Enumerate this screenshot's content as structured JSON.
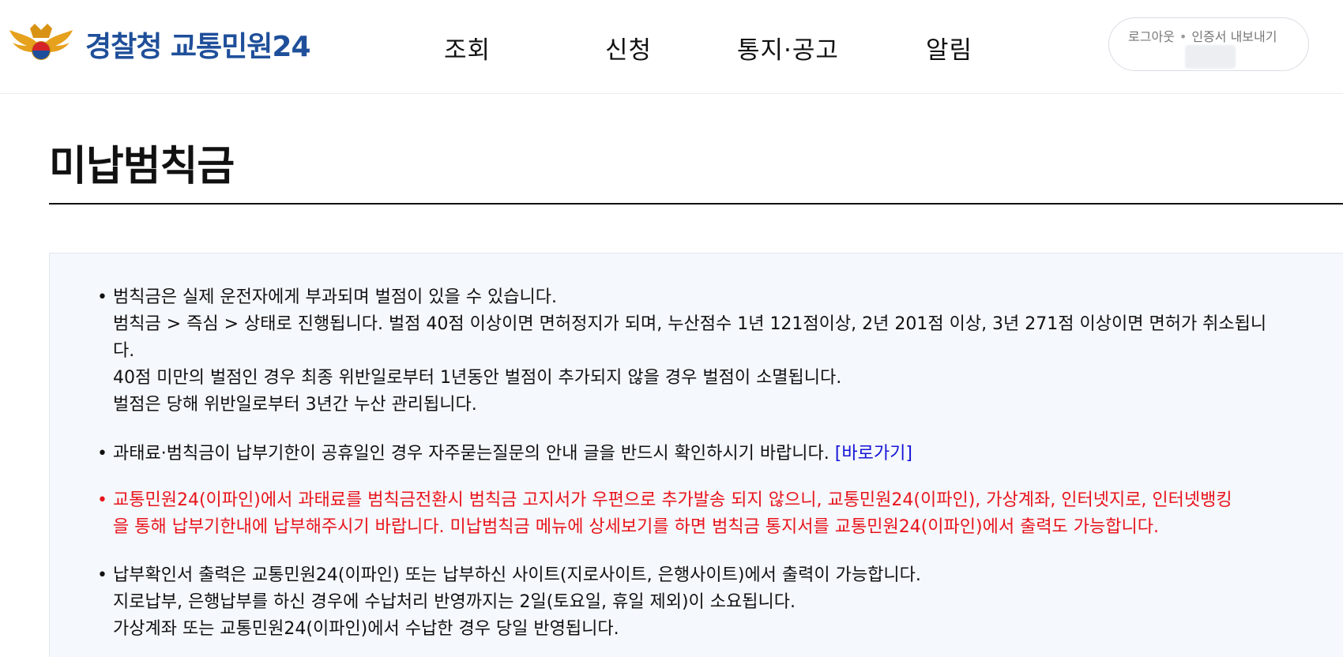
{
  "header": {
    "logo_brand": "경찰청",
    "logo_service": "교통민원24",
    "nav": [
      "조회",
      "신청",
      "통지·공고",
      "알림"
    ],
    "user_links": {
      "logout": "로그아웃",
      "export_cert": "인증서 내보내기"
    }
  },
  "page": {
    "title": "미납범칙금"
  },
  "notes": [
    {
      "bullet": "•",
      "lines": [
        "범칙금은 실제 운전자에게 부과되며 벌점이 있을 수 있습니다.",
        "범칙금 > 즉심 > 상태로 진행됩니다. 벌점 40점 이상이면 면허정지가 되며, 누산점수 1년 121점이상, 2년 201점 이상, 3년 271점 이상이면 면허가 취소됩니",
        "다.",
        "40점 미만의 벌점인 경우 최종 위반일로부터 1년동안 벌점이 추가되지 않을 경우 벌점이 소멸됩니다.",
        "벌점은 당해 위반일로부터 3년간 누산 관리됩니다."
      ]
    },
    {
      "bullet": "•",
      "text": "과태료·범칙금이 납부기한이 공휴일인 경우 자주묻는질문의 안내 글을 반드시 확인하시기 바랍니다.",
      "link": "[바로가기]"
    },
    {
      "bullet": "•",
      "lines": [
        "교통민원24(이파인)에서 과태료를 범칙금전환시 범칙금 고지서가 우편으로 추가발송 되지 않으니, 교통민원24(이파인), 가상계좌, 인터넷지로, 인터넷뱅킹",
        "을 통해 납부기한내에 납부해주시기 바랍니다. 미납범칙금 메뉴에 상세보기를 하면 범칙금 통지서를 교통민원24(이파인)에서 출력도 가능합니다."
      ]
    },
    {
      "bullet": "•",
      "lines": [
        "납부확인서 출력은 교통민원24(이파인) 또는 납부하신 사이트(지로사이트, 은행사이트)에서 출력이 가능합니다.",
        "지로납부, 은행납부를 하신 경우에 수납처리 반영까지는 2일(토요일, 휴일 제외)이 소요됩니다.",
        "가상계좌 또는 교통민원24(이파인)에서 수납한 경우 당일 반영됩니다."
      ]
    }
  ],
  "colors": {
    "brand_blue": "#1f4f9a",
    "warning_red": "#e8141c",
    "link_blue": "#1515d6",
    "info_bg": "#f5f8fc"
  }
}
